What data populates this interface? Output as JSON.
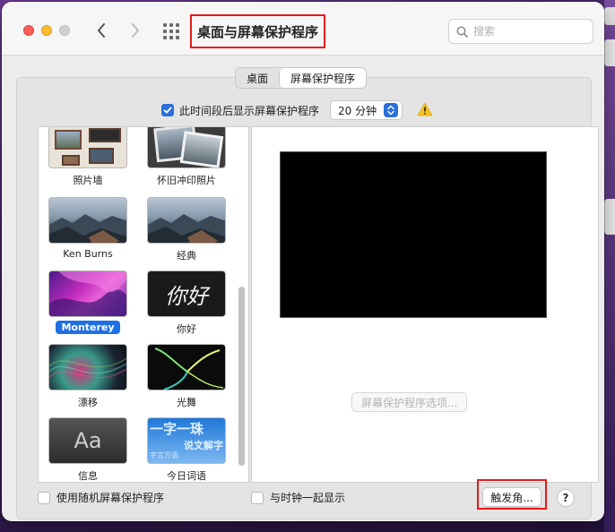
{
  "window": {
    "title": "桌面与屏幕保护程序"
  },
  "search": {
    "placeholder": "搜索"
  },
  "tabs": [
    {
      "label": "桌面",
      "active": false
    },
    {
      "label": "屏幕保护程序",
      "active": true
    }
  ],
  "schedule": {
    "checkbox_label": "此时间段后显示屏幕保护程序",
    "checked": true,
    "duration": "20 分钟"
  },
  "savers": [
    {
      "label": "照片墙"
    },
    {
      "label": "怀旧冲印照片"
    },
    {
      "label": "Ken Burns"
    },
    {
      "label": "经典"
    },
    {
      "label": "Monterey",
      "selected": true
    },
    {
      "label": "你好",
      "thumb_text": "你好"
    },
    {
      "label": "漂移"
    },
    {
      "label": "光舞"
    },
    {
      "label": "信息",
      "thumb_text": "Aa"
    },
    {
      "label": "今日词语",
      "thumb_text": "一字一珠",
      "thumb_sub": "说文解字",
      "thumb_small": "字言万语"
    }
  ],
  "preview": {
    "options_label": "屏幕保护程序选项..."
  },
  "bottom": {
    "random_label": "使用随机屏幕保护程序",
    "clock_label": "与时钟一起显示",
    "hot_corners_label": "触发角...",
    "help_label": "?"
  },
  "colors": {
    "accent": "#2a6fdb",
    "highlight_outline": "#e81818"
  }
}
